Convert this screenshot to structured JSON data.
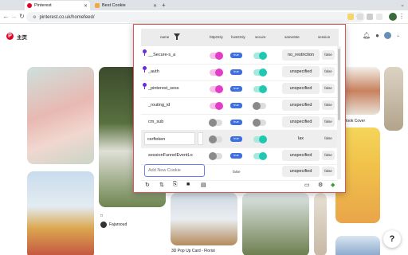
{
  "browser": {
    "tabs": [
      {
        "title": "Pinterest",
        "active": true,
        "favicon_color": "#e60023"
      },
      {
        "title": "Best Cookie",
        "active": false,
        "favicon_color": "#f2a93b"
      }
    ],
    "new_tab": "+",
    "url": "pinterest.co.uk/homefeed/"
  },
  "pinterest": {
    "home_label": "主页",
    "caption_book": "Book Cover",
    "caption_pop": "3D Pop Up Card - Florist",
    "user_name": "Fajarsoud",
    "help_label": "?"
  },
  "cookie_panel": {
    "columns": {
      "name": "name",
      "httponly": "httpOnly",
      "hostonly": "hostOnly",
      "secure": "secure",
      "samesite": "sameSite",
      "session": "session"
    },
    "rows": [
      {
        "name": "__Secure-s_a",
        "pinned": true,
        "httponly": true,
        "hostonly": "true",
        "secure": true,
        "samesite": "no_restriction",
        "session": "false",
        "selected": false
      },
      {
        "name": "_auth",
        "pinned": true,
        "httponly": true,
        "hostonly": "true",
        "secure": true,
        "samesite": "unspecified",
        "session": "false",
        "selected": false
      },
      {
        "name": "_pinterest_sess",
        "pinned": true,
        "httponly": true,
        "hostonly": "true",
        "secure": true,
        "samesite": "unspecified",
        "session": "false",
        "selected": false
      },
      {
        "name": "_routing_id",
        "pinned": false,
        "httponly": true,
        "hostonly": "true",
        "secure": false,
        "samesite": "unspecified",
        "session": "false",
        "selected": false
      },
      {
        "name": "cm_sub",
        "pinned": false,
        "httponly": false,
        "hostonly": "true",
        "secure": false,
        "samesite": "unspecified",
        "session": "false",
        "selected": false
      },
      {
        "name": "csrftoken",
        "pinned": false,
        "httponly": false,
        "hostonly": "true",
        "secure": true,
        "samesite": "lax",
        "session": "false",
        "selected": true
      },
      {
        "name": "sessionFunnelEventLo",
        "pinned": false,
        "httponly": false,
        "hostonly": "true",
        "secure": true,
        "samesite": "unspecified",
        "session": "false",
        "selected": false
      }
    ],
    "new_row": {
      "placeholder": "Add New Cookie",
      "hostonly": "false",
      "samesite": "unspecified",
      "session": "false"
    },
    "colors": {
      "httponly_on": "#e43bc8",
      "secure_on": "#1fc8b0",
      "badge": "#3d6fe0",
      "border": "#e05555"
    }
  }
}
